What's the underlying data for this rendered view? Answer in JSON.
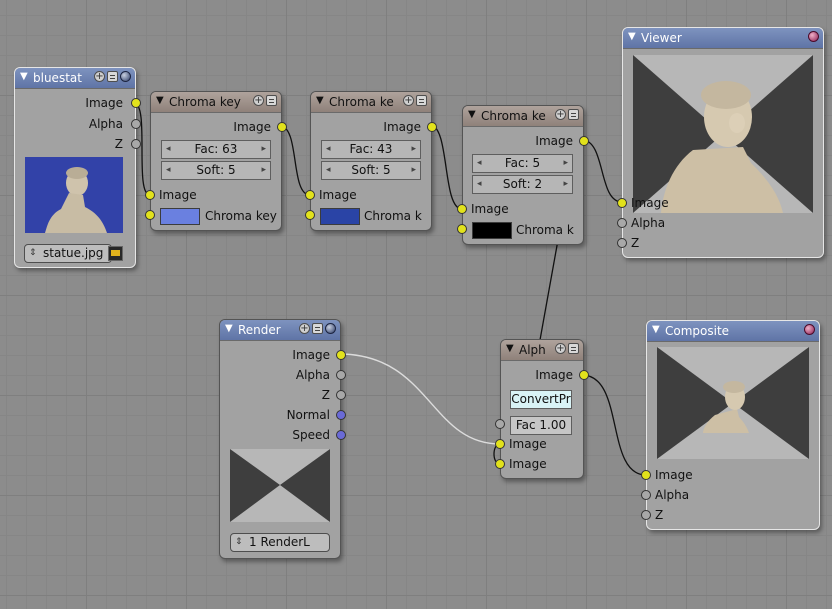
{
  "nodes": {
    "image": {
      "title": "bluestat",
      "outputs": [
        "Image",
        "Alpha",
        "Z"
      ],
      "file": "statue.jpg"
    },
    "chroma1": {
      "title": "Chroma key",
      "output": "Image",
      "fac": "Fac: 63",
      "soft": "Soft: 5",
      "input_image": "Image",
      "input_key": "Chroma key",
      "key_color": "#6a80e0"
    },
    "chroma2": {
      "title": "Chroma ke",
      "output": "Image",
      "fac": "Fac: 43",
      "soft": "Soft: 5",
      "input_image": "Image",
      "input_key": "Chroma k",
      "key_color": "#2a44a6"
    },
    "chroma3": {
      "title": "Chroma ke",
      "output": "Image",
      "fac": "Fac: 5",
      "soft": "Soft: 2",
      "input_image": "Image",
      "input_key": "Chroma k",
      "key_color": "#000000"
    },
    "viewer": {
      "title": "Viewer",
      "inputs": [
        "Image",
        "Alpha",
        "Z"
      ]
    },
    "render": {
      "title": "Render",
      "outputs": [
        "Image",
        "Alpha",
        "Z",
        "Normal",
        "Speed"
      ],
      "layer": "1 RenderL"
    },
    "alpha": {
      "title": "Alph",
      "output": "Image",
      "convert": "ConvertPr",
      "fac": "Fac 1.00",
      "inputs": [
        "Image",
        "Image"
      ]
    },
    "composite": {
      "title": "Composite",
      "inputs": [
        "Image",
        "Alpha",
        "Z"
      ]
    }
  },
  "colors": {
    "image_socket": "#e2e21c",
    "value_socket": "#a8a8a8",
    "vector_socket": "#6a6ad6",
    "header_blue": "#6b80b0",
    "header_brown": "#9c8f88",
    "background": "#8c8c8c"
  },
  "icons": {
    "collapse": "triangle-down-icon",
    "plus": "plus-icon",
    "options": "list-icon",
    "preview": "sphere-icon",
    "output_dot": "record-icon"
  }
}
